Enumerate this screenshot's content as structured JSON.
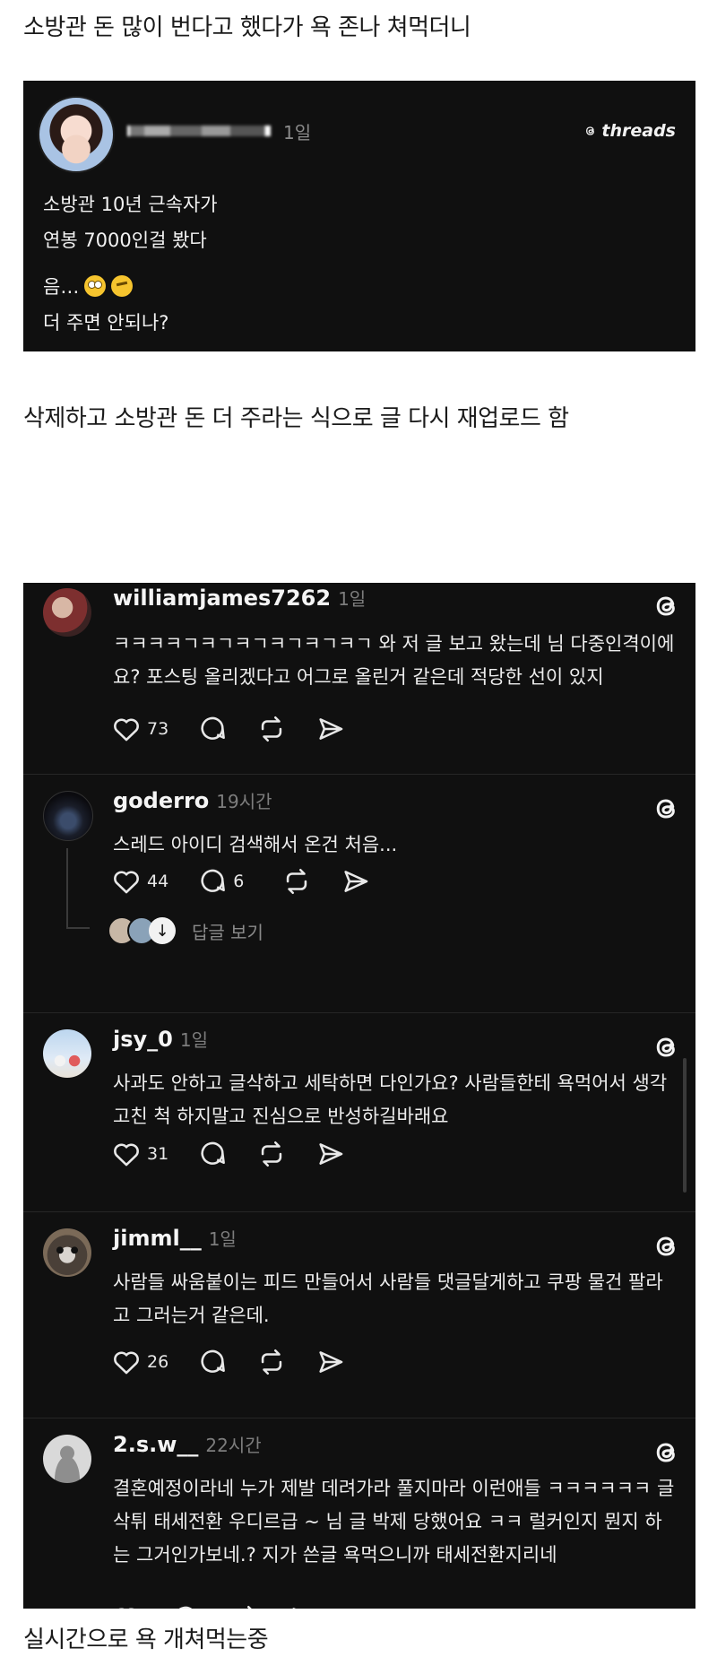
{
  "captions": {
    "top": "소방관 돈 많이 번다고 했다가 욕 존나 쳐먹더니",
    "middle": "삭제하고 소방관 돈 더 주라는 식으로 글 다시 재업로드 함",
    "bottom": "실시간으로 욕 개쳐먹는중"
  },
  "post": {
    "time": "1일",
    "brand": "threads",
    "lines": [
      "소방관 10년 근속자가",
      "연봉 7000인걸 봤다"
    ],
    "line3": "음…",
    "line4": "더 주면 안되나?",
    "emoji": [
      "face-with-rolling-eyes",
      "thinking-face"
    ]
  },
  "comments": [
    {
      "username": "williamjames7262",
      "time": "1일",
      "text": "ㅋㅋㅋㅋㄱㅋㄱㅋㄱㅋㄱㅋㄱㅋㄱ 와 저 글 보고 왔는데 님 다중인격이에요? 포스팅 올리겠다고 어그로 올린거 같은데 적당한 선이 있지",
      "likes": "73",
      "replies": ""
    },
    {
      "username": "goderro",
      "time": "19시간",
      "text": "스레드 아이디 검색해서 온건 처음...",
      "likes": "44",
      "replies": "6",
      "view_replies": "답글 보기"
    },
    {
      "username": "jsy_0",
      "time": "1일",
      "text": "사과도 안하고 글삭하고 세탁하면 다인가요? 사람들한테 욕먹어서 생각 고친 척 하지말고 진심으로 반성하길바래요",
      "likes": "31",
      "replies": ""
    },
    {
      "username": "jimml__",
      "time": "1일",
      "text": "사람들 싸움붙이는 피드 만들어서 사람들 댓글달게하고 쿠팡 물건 팔라고 그러는거 같은데.",
      "likes": "26",
      "replies": ""
    },
    {
      "username": "2.s.w__",
      "time": "22시간",
      "text": "결혼예정이라네 누가 제발 데려가라 풀지마라 이런애들 ㅋㅋㅋㅋㅋㅋ 글삭튀 태세전환 우디르급 ~ 님 글 박제 당했어요 ㅋㅋ 럴커인지 뭔지 하는 그거인가보네.? 지가 쓴글 욕먹으니까 태세전환지리네",
      "likes": "",
      "replies": ""
    }
  ],
  "colors": {
    "card_bg": "#101010",
    "text_primary": "#f3f3f3",
    "text_secondary": "#7d7d7d",
    "divider": "#262626"
  },
  "icons": [
    "heart-icon",
    "comment-icon",
    "repost-icon",
    "share-icon",
    "threads-logo-icon",
    "arrow-down-icon"
  ]
}
